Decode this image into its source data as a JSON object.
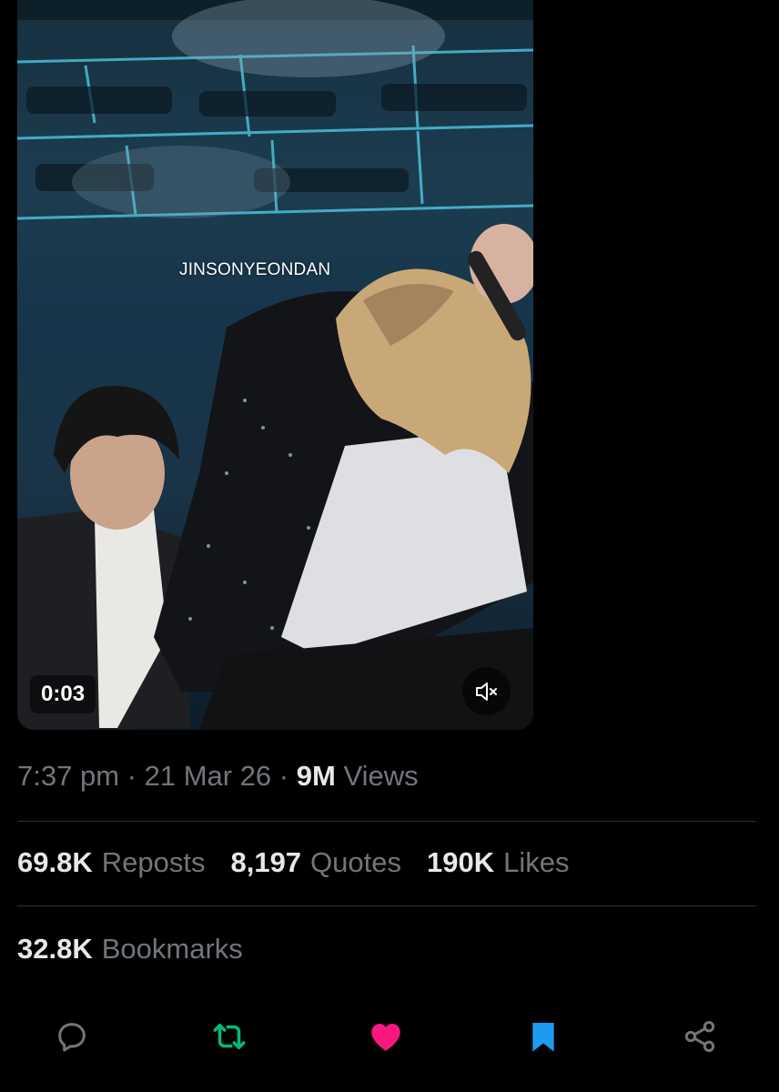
{
  "video": {
    "watermark": "JINSONYEONDAN",
    "time": "0:03"
  },
  "meta": {
    "time": "7:37 pm",
    "sep1": "·",
    "date": "21 Mar 26",
    "sep2": "·",
    "views_count": "9M",
    "views_label": "Views"
  },
  "stats": {
    "reposts": {
      "count": "69.8K",
      "label": "Reposts"
    },
    "quotes": {
      "count": "8,197",
      "label": "Quotes"
    },
    "likes": {
      "count": "190K",
      "label": "Likes"
    },
    "bookmarks": {
      "count": "32.8K",
      "label": "Bookmarks"
    }
  },
  "actions": [
    {
      "icon": "reply-icon",
      "color": "#71767b"
    },
    {
      "icon": "repost-icon",
      "color": "#00ba7c"
    },
    {
      "icon": "heart-icon",
      "color": "#f91880"
    },
    {
      "icon": "bookmark-icon",
      "color": "#1d9bf0"
    },
    {
      "icon": "share-icon",
      "color": "#71767b"
    }
  ]
}
